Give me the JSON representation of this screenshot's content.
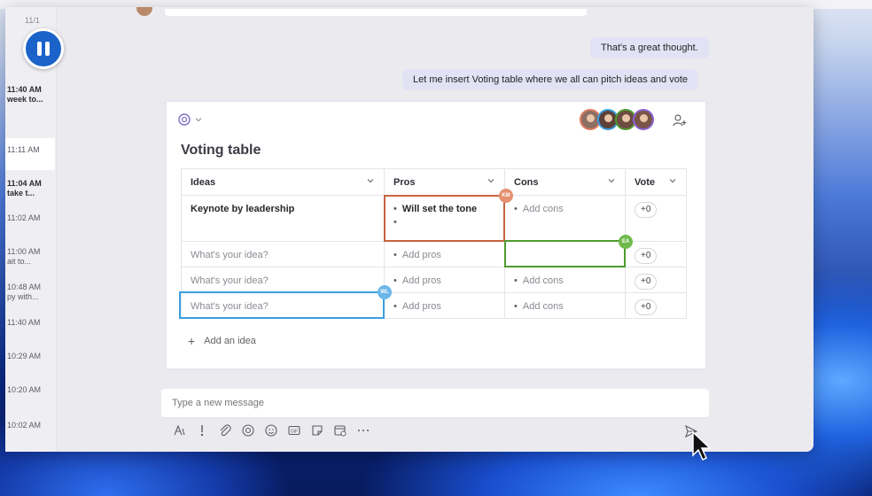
{
  "chat_list": {
    "date": "11/1",
    "items": [
      {
        "time": "11:40 AM",
        "preview": "week to..."
      },
      {
        "time": "11:11 AM",
        "preview": ""
      },
      {
        "time": "11:04 AM",
        "preview": "take t..."
      },
      {
        "time": "11:02 AM",
        "preview": ""
      },
      {
        "time": "11:00 AM",
        "preview": "ait to..."
      },
      {
        "time": "10:48 AM",
        "preview": "py with..."
      },
      {
        "time": "11:40 AM",
        "preview": ""
      },
      {
        "time": "10:29 AM",
        "preview": ""
      },
      {
        "time": "10:20 AM",
        "preview": ""
      },
      {
        "time": "10:02 AM",
        "preview": ""
      }
    ]
  },
  "messages": [
    {
      "text": "That's a great thought."
    },
    {
      "text": "Let me insert Voting table where we all can pitch ideas and vote"
    }
  ],
  "card": {
    "title": "Voting table",
    "columns": [
      "Ideas",
      "Pros",
      "Cons",
      "Vote"
    ],
    "rows": [
      {
        "idea": "Keynote by leadership",
        "pros": "Will set the tone",
        "cons": "Add cons",
        "vote": "+0"
      },
      {
        "idea": "What's your idea?",
        "pros": "Add pros",
        "cons": "",
        "vote": "+0"
      },
      {
        "idea": "What's your idea?",
        "pros": "Add pros",
        "cons": "Add cons",
        "vote": "+0"
      },
      {
        "idea": "What's your idea?",
        "pros": "Add pros",
        "cons": "Add cons",
        "vote": "+0"
      }
    ],
    "presence": [
      {
        "initials": "KM",
        "color": "#c8633e"
      },
      {
        "initials": "EA",
        "color": "#4f9a2e"
      },
      {
        "initials": "WL",
        "color": "#3a9ee0"
      }
    ],
    "avatar_colors": [
      "#e07a5f",
      "#3a9ee0",
      "#4f9a2e",
      "#8a63d2"
    ],
    "add_idea_label": "Add an idea"
  },
  "compose": {
    "placeholder": "Type a new message"
  }
}
